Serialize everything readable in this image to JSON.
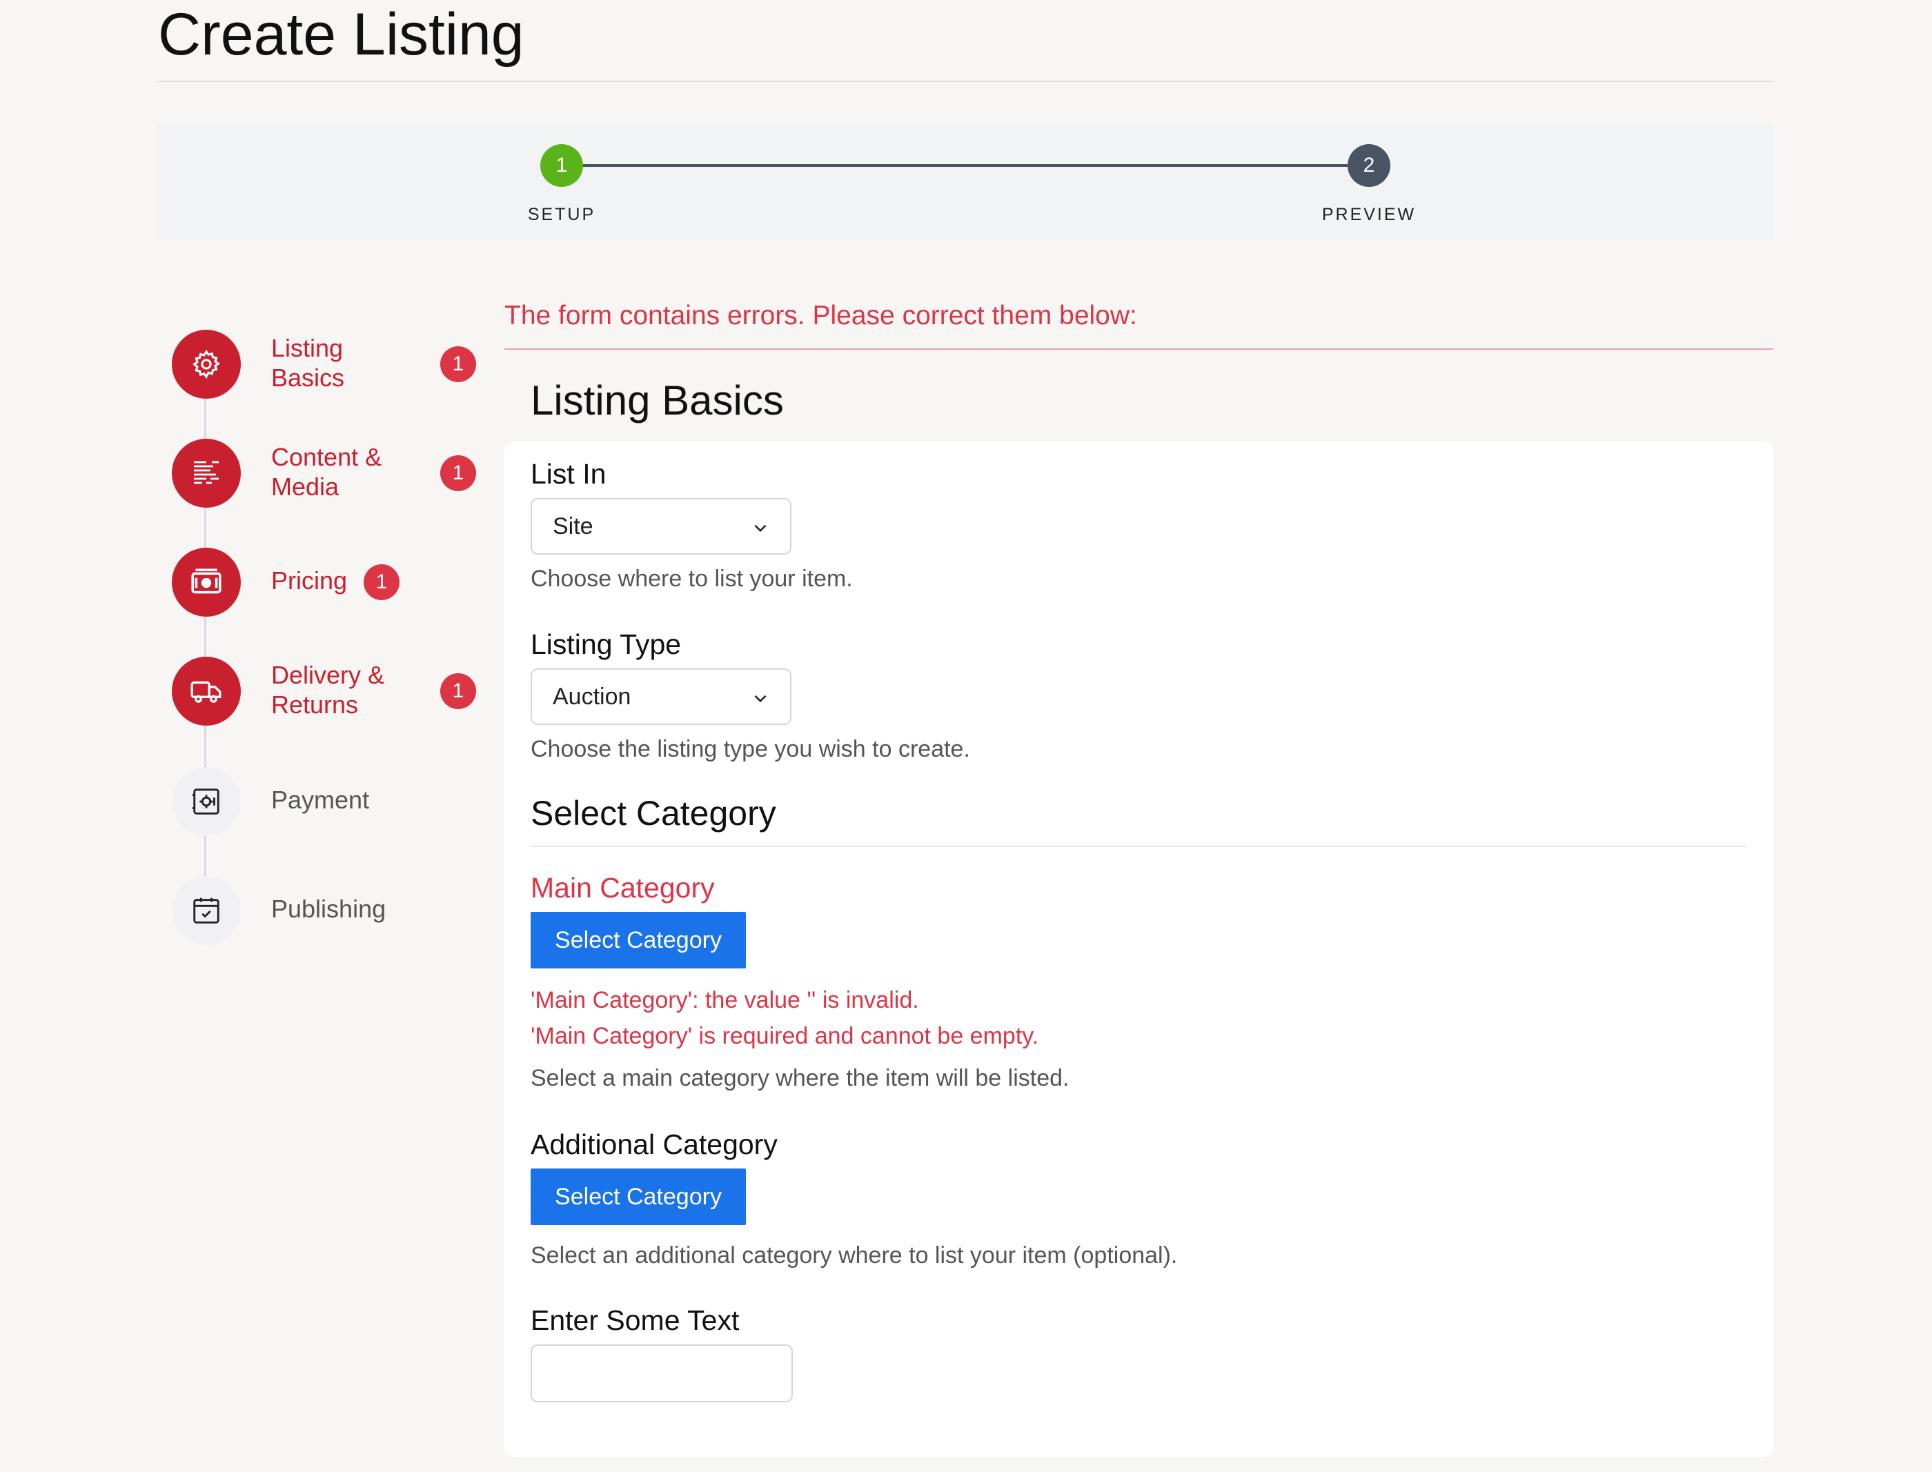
{
  "page": {
    "title": "Create Listing"
  },
  "stepper": {
    "steps": [
      {
        "number": "1",
        "label": "SETUP",
        "color": "#5bb31a"
      },
      {
        "number": "2",
        "label": "PREVIEW",
        "color": "#4a5462"
      }
    ]
  },
  "sidebar": {
    "active_color": "#c8202f",
    "items": [
      {
        "label_lines": [
          "Listing",
          "Basics"
        ],
        "error_count": "1",
        "icon": "gear-icon",
        "state": "error"
      },
      {
        "label_lines": [
          "Content &",
          "Media"
        ],
        "error_count": "1",
        "icon": "text-lines-icon",
        "state": "error"
      },
      {
        "label_lines": [
          "Pricing"
        ],
        "error_count": "1",
        "icon": "money-icon",
        "state": "error"
      },
      {
        "label_lines": [
          "Delivery &",
          "Returns"
        ],
        "error_count": "1",
        "icon": "truck-icon",
        "state": "error"
      },
      {
        "label_lines": [
          "Payment"
        ],
        "icon": "safe-icon",
        "state": "inactive"
      },
      {
        "label_lines": [
          "Publishing"
        ],
        "icon": "calendar-check-icon",
        "state": "inactive"
      }
    ]
  },
  "form": {
    "error_summary": "The form contains errors. Please correct them below:",
    "section_title": "Listing Basics",
    "list_in": {
      "label": "List In",
      "value": "Site",
      "help": "Choose where to list your item."
    },
    "listing_type": {
      "label": "Listing Type",
      "value": "Auction",
      "help": "Choose the listing type you wish to create."
    },
    "select_category": {
      "title": "Select Category",
      "main": {
        "label": "Main Category",
        "button": "Select Category",
        "errors": [
          "'Main Category': the value '' is invalid.",
          "'Main Category' is required and cannot be empty."
        ],
        "help": "Select a main category where the item will be listed."
      },
      "additional": {
        "label": "Additional Category",
        "button": "Select Category",
        "help": "Select an additional category where to list your item (optional)."
      }
    },
    "text_field": {
      "label": "Enter Some Text",
      "value": ""
    }
  },
  "colors": {
    "error": "#dc3545",
    "primary": "#1a73e8",
    "step_done": "#5bb31a",
    "step_pending": "#4a5462"
  }
}
